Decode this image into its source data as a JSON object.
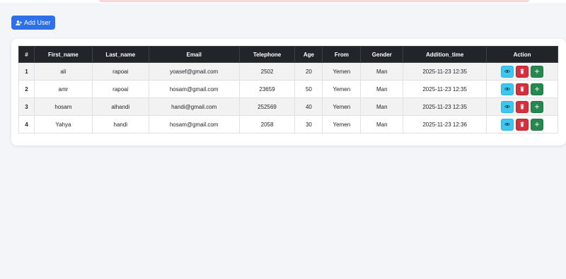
{
  "toolbar": {
    "add_user_label": "Add User"
  },
  "table": {
    "headers": [
      "#",
      "First_name",
      "Last_name",
      "Email",
      "Telephone",
      "Age",
      "From",
      "Gender",
      "Addition_time",
      "Action"
    ],
    "rows": [
      {
        "index": "1",
        "first_name": "ali",
        "last_name": "rapoai",
        "email": "yoasef@gmail.com",
        "telephone": "2502",
        "age": "20",
        "from": "Yemen",
        "gender": "Man",
        "addition_time": "2025-11-23 12:35"
      },
      {
        "index": "2",
        "first_name": "amr",
        "last_name": "rapoai",
        "email": "hosam@gmail.com",
        "telephone": "23659",
        "age": "50",
        "from": "Yemen",
        "gender": "Man",
        "addition_time": "2025-11-23 12:35"
      },
      {
        "index": "3",
        "first_name": "hosam",
        "last_name": "alhandi",
        "email": "handi@gmail.com",
        "telephone": "252569",
        "age": "40",
        "from": "Yemen",
        "gender": "Man",
        "addition_time": "2025-11-23 12:35"
      },
      {
        "index": "4",
        "first_name": "Yahya",
        "last_name": "handi",
        "email": "hosam@gmail.com",
        "telephone": "2058",
        "age": "30",
        "from": "Yemen",
        "gender": "Man",
        "addition_time": "2025-11-23 12:36"
      }
    ]
  },
  "icons": {
    "add_user": "user-plus-icon",
    "view": "eye-icon",
    "delete": "trash-icon",
    "add": "plus-icon"
  },
  "colors": {
    "background": "#f4f5f9",
    "primary": "#2f6fe8",
    "header_dark": "#212529",
    "view_button": "#3dc7ee",
    "delete_button": "#d6303f",
    "add_button": "#278750",
    "alert_strip": "#f8d7da"
  }
}
